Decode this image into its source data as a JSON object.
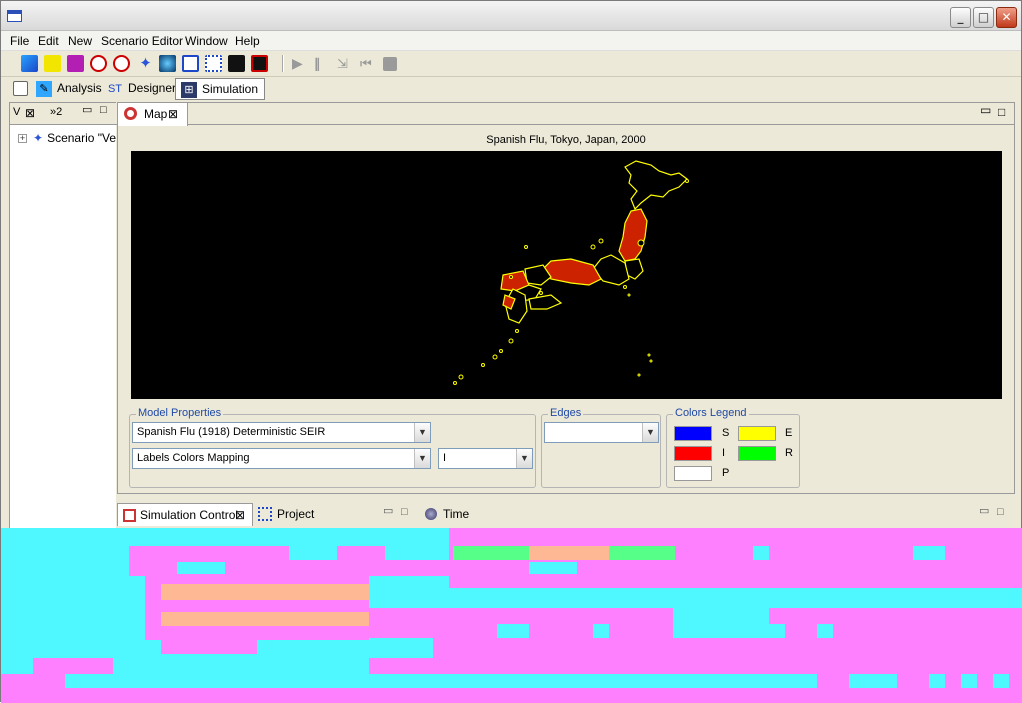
{
  "window": {
    "minimize": "_",
    "maximize": "□",
    "close": "✕"
  },
  "menu": [
    "File",
    "Edit",
    "New",
    "Scenario Editor",
    "Window",
    "Help"
  ],
  "perspectives": {
    "analysis": "Analysis",
    "designer": "Designer",
    "simulation": "Simulation"
  },
  "left_panel": {
    "tab1": "V",
    "tab2": "»2",
    "tree_item": "Scenario \"Ve"
  },
  "map_view": {
    "tab_label": "Map",
    "title": "Spanish Flu, Tokyo, Japan, 2000"
  },
  "model_properties": {
    "label": "Model Properties",
    "model_select": "Spanish Flu (1918) Deterministic SEIR",
    "mapping_select": "Labels Colors Mapping",
    "state_select": "I"
  },
  "edges": {
    "label": "Edges",
    "value": ""
  },
  "legend": {
    "label": "Colors Legend",
    "items": [
      {
        "key": "S",
        "color": "#0000ff"
      },
      {
        "key": "E",
        "color": "#ffff00"
      },
      {
        "key": "I",
        "color": "#ff0000"
      },
      {
        "key": "R",
        "color": "#00ff00"
      },
      {
        "key": "P",
        "color": "#ffffff"
      }
    ]
  },
  "bottom_tabs": {
    "simulation_control": "Simulation Control",
    "project_explorer": "Project Explorer",
    "time": "Time"
  },
  "colors": {
    "map_bg": "#000000",
    "border": "#ffff00",
    "infected": "#cc2200",
    "glitch_cyan": "#4ff8ff",
    "glitch_pink": "#ff80ff",
    "glitch_peach": "#ffb894"
  }
}
